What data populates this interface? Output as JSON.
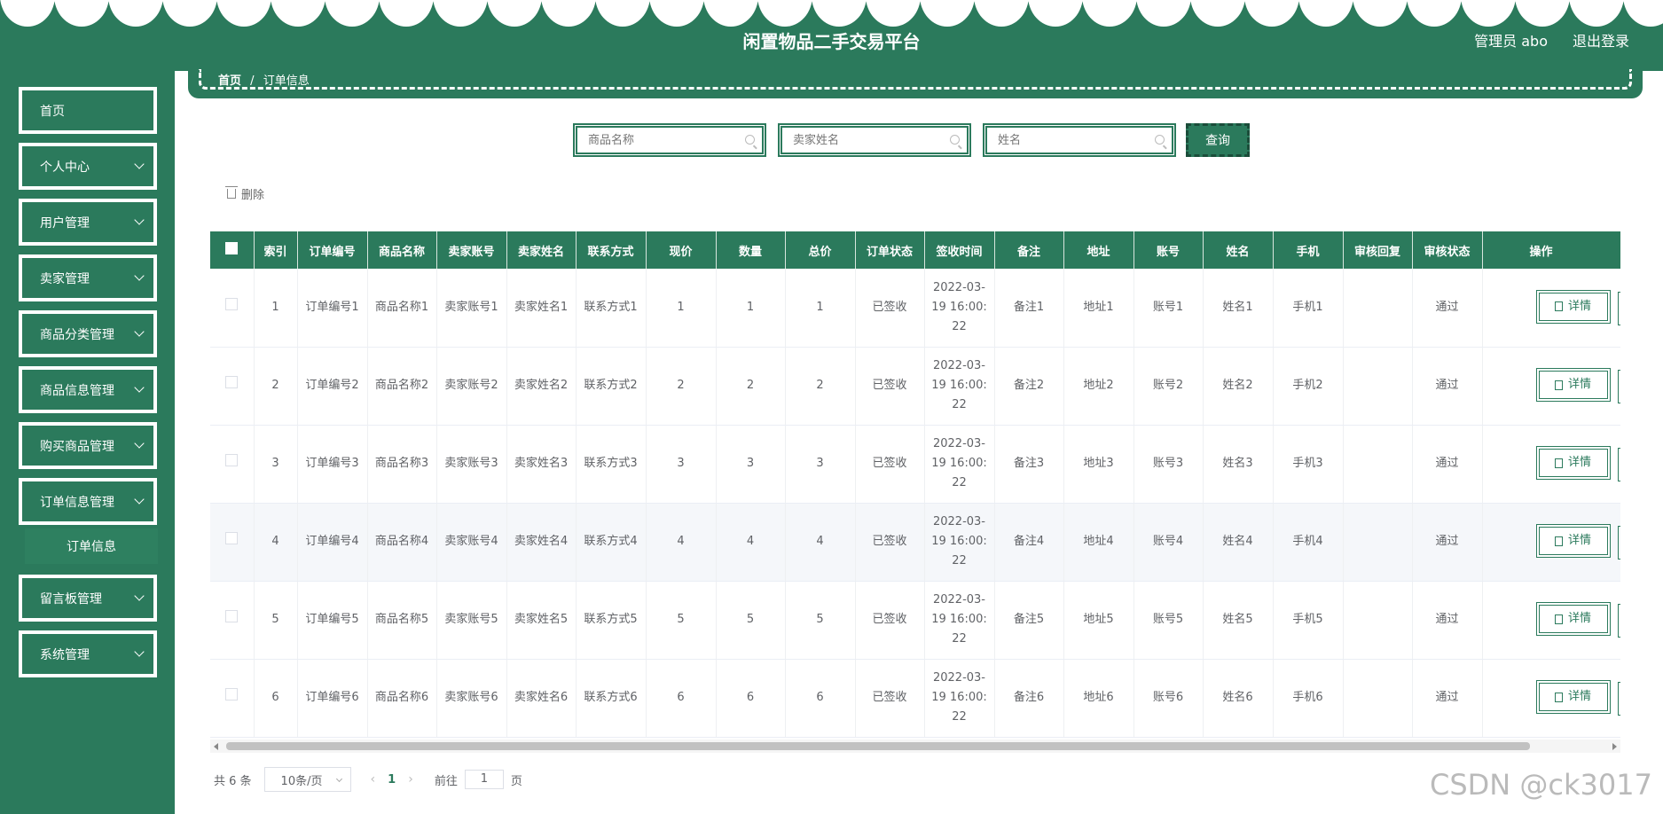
{
  "header": {
    "title": "闲置物品二手交易平台",
    "user": "管理员 abo",
    "logout": "退出登录"
  },
  "sidebar": {
    "items": [
      {
        "label": "首页",
        "has_arrow": false
      },
      {
        "label": "个人中心",
        "has_arrow": true
      },
      {
        "label": "用户管理",
        "has_arrow": true
      },
      {
        "label": "卖家管理",
        "has_arrow": true
      },
      {
        "label": "商品分类管理",
        "has_arrow": true
      },
      {
        "label": "商品信息管理",
        "has_arrow": true
      },
      {
        "label": "购买商品管理",
        "has_arrow": true
      },
      {
        "label": "订单信息管理",
        "has_arrow": true
      },
      {
        "label": "留言板管理",
        "has_arrow": true
      },
      {
        "label": "系统管理",
        "has_arrow": true
      }
    ],
    "submenu": {
      "label": "订单信息"
    }
  },
  "breadcrumb": {
    "home": "首页",
    "sep": "/",
    "current": "订单信息"
  },
  "search": {
    "product_placeholder": "商品名称",
    "seller_placeholder": "卖家姓名",
    "name_placeholder": "姓名",
    "query_label": "查询"
  },
  "toolbar": {
    "delete_label": "删除"
  },
  "table": {
    "columns": [
      "索引",
      "订单编号",
      "商品名称",
      "卖家账号",
      "卖家姓名",
      "联系方式",
      "现价",
      "数量",
      "总价",
      "订单状态",
      "签收时间",
      "备注",
      "地址",
      "账号",
      "姓名",
      "手机",
      "审核回复",
      "审核状态",
      "操作"
    ],
    "detail_label": "详情",
    "rows": [
      {
        "idx": "1",
        "order_no": "订单编号1",
        "product": "商品名称1",
        "seller_acct": "卖家账号1",
        "seller_name": "卖家姓名1",
        "contact": "联系方式1",
        "price": "1",
        "qty": "1",
        "total": "1",
        "status": "已签收",
        "sign_time": "2022-03-19 16:00:22",
        "remark": "备注1",
        "address": "地址1",
        "account": "账号1",
        "name": "姓名1",
        "phone": "手机1",
        "reply": "",
        "audit": "通过"
      },
      {
        "idx": "2",
        "order_no": "订单编号2",
        "product": "商品名称2",
        "seller_acct": "卖家账号2",
        "seller_name": "卖家姓名2",
        "contact": "联系方式2",
        "price": "2",
        "qty": "2",
        "total": "2",
        "status": "已签收",
        "sign_time": "2022-03-19 16:00:22",
        "remark": "备注2",
        "address": "地址2",
        "account": "账号2",
        "name": "姓名2",
        "phone": "手机2",
        "reply": "",
        "audit": "通过"
      },
      {
        "idx": "3",
        "order_no": "订单编号3",
        "product": "商品名称3",
        "seller_acct": "卖家账号3",
        "seller_name": "卖家姓名3",
        "contact": "联系方式3",
        "price": "3",
        "qty": "3",
        "total": "3",
        "status": "已签收",
        "sign_time": "2022-03-19 16:00:22",
        "remark": "备注3",
        "address": "地址3",
        "account": "账号3",
        "name": "姓名3",
        "phone": "手机3",
        "reply": "",
        "audit": "通过"
      },
      {
        "idx": "4",
        "order_no": "订单编号4",
        "product": "商品名称4",
        "seller_acct": "卖家账号4",
        "seller_name": "卖家姓名4",
        "contact": "联系方式4",
        "price": "4",
        "qty": "4",
        "total": "4",
        "status": "已签收",
        "sign_time": "2022-03-19 16:00:22",
        "remark": "备注4",
        "address": "地址4",
        "account": "账号4",
        "name": "姓名4",
        "phone": "手机4",
        "reply": "",
        "audit": "通过"
      },
      {
        "idx": "5",
        "order_no": "订单编号5",
        "product": "商品名称5",
        "seller_acct": "卖家账号5",
        "seller_name": "卖家姓名5",
        "contact": "联系方式5",
        "price": "5",
        "qty": "5",
        "total": "5",
        "status": "已签收",
        "sign_time": "2022-03-19 16:00:22",
        "remark": "备注5",
        "address": "地址5",
        "account": "账号5",
        "name": "姓名5",
        "phone": "手机5",
        "reply": "",
        "audit": "通过"
      },
      {
        "idx": "6",
        "order_no": "订单编号6",
        "product": "商品名称6",
        "seller_acct": "卖家账号6",
        "seller_name": "卖家姓名6",
        "contact": "联系方式6",
        "price": "6",
        "qty": "6",
        "total": "6",
        "status": "已签收",
        "sign_time": "2022-03-19 16:00:22",
        "remark": "备注6",
        "address": "地址6",
        "account": "账号6",
        "name": "姓名6",
        "phone": "手机6",
        "reply": "",
        "audit": "通过"
      }
    ]
  },
  "pagination": {
    "total": "共 6 条",
    "page_size": "10条/页",
    "current_page": "1",
    "goto_label": "前往",
    "goto_value": "1",
    "page_suffix": "页"
  },
  "watermark": "CSDN @ck3017",
  "colors": {
    "primary": "#2b7a5c",
    "white": "#ffffff"
  }
}
